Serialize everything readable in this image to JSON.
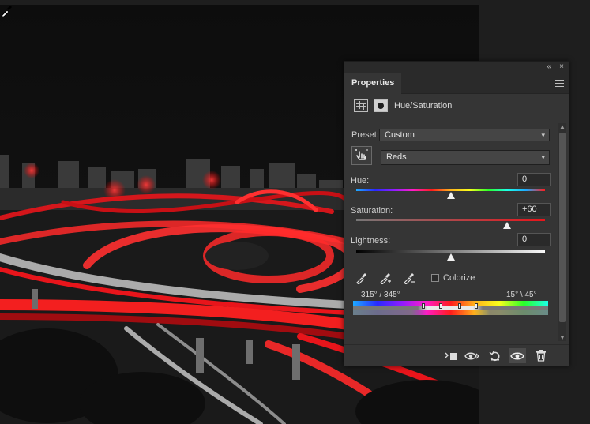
{
  "panel": {
    "tab_label": "Properties",
    "adjustment_title": "Hue/Saturation",
    "preset_label": "Preset:",
    "preset_value": "Custom",
    "channel_value": "Reds",
    "hue_label": "Hue:",
    "hue_value": "0",
    "hue_level": 0.5,
    "saturation_label": "Saturation:",
    "saturation_value": "+60",
    "saturation_level": 0.8,
    "lightness_label": "Lightness:",
    "lightness_value": "0",
    "lightness_level": 0.5,
    "colorize_label": "Colorize",
    "colorize_checked": false,
    "range_left": "315° /  345°",
    "range_right": "15° \\ 45°"
  },
  "icons": {
    "collapse": "«",
    "close": "×",
    "chevron": "▾",
    "scroll_up": "▲",
    "scroll_down": "▼"
  },
  "colors": {
    "accent_red": "#e8151b",
    "panel_bg": "#353535"
  }
}
